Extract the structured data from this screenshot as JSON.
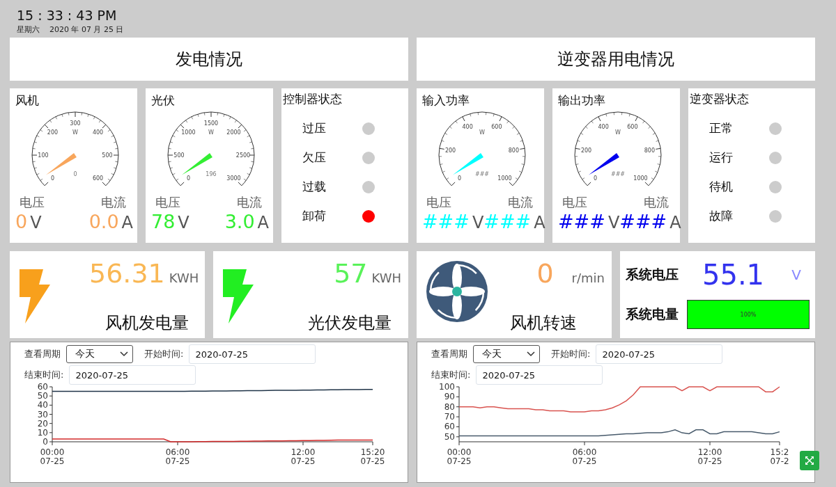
{
  "clock": {
    "time": "15 : 33 : 43 PM",
    "weekday": "星期六",
    "date": "2020 年 07 月 25 日"
  },
  "sections": [
    {
      "title": "发电情况",
      "gauges": [
        {
          "title": "风机",
          "unit": "W",
          "ticks": [
            "0",
            "100",
            "200",
            "300",
            "400",
            "500",
            "600"
          ],
          "reading": "0",
          "color": "#f8a65c",
          "voltage_label": "电压",
          "current_label": "电流",
          "voltage": "0",
          "voltage_unit": "V",
          "current": "0.0",
          "current_unit": "A"
        },
        {
          "title": "光伏",
          "unit": "W",
          "ticks": [
            "0",
            "500",
            "1000",
            "1500",
            "2000",
            "2500",
            "3000"
          ],
          "reading": "196",
          "color": "#33ee33",
          "voltage_label": "电压",
          "current_label": "电流",
          "voltage": "78",
          "voltage_unit": "V",
          "current": "3.0",
          "current_unit": "A"
        }
      ],
      "status": {
        "title": "控制器状态",
        "items": [
          {
            "label": "过压",
            "on": false
          },
          {
            "label": "欠压",
            "on": false
          },
          {
            "label": "过载",
            "on": false
          },
          {
            "label": "卸荷",
            "on": true
          }
        ]
      }
    },
    {
      "title": "逆变器用电情况",
      "gauges": [
        {
          "title": "输入功率",
          "unit": "W",
          "ticks": [
            "0",
            "200",
            "400",
            "600",
            "800",
            "1000"
          ],
          "reading": "###",
          "color": "#00ffff",
          "voltage_label": "电压",
          "current_label": "电流",
          "voltage": "###",
          "voltage_unit": "V",
          "current": "###",
          "current_unit": "A"
        },
        {
          "title": "输出功率",
          "unit": "W",
          "ticks": [
            "0",
            "200",
            "400",
            "600",
            "800",
            "1000"
          ],
          "reading": "###",
          "color": "#0000ee",
          "voltage_label": "电压",
          "current_label": "电流",
          "voltage": "###",
          "voltage_unit": "V",
          "current": "###",
          "current_unit": "A"
        }
      ],
      "status": {
        "title": "逆变器状态",
        "items": [
          {
            "label": "正常",
            "on": false
          },
          {
            "label": "运行",
            "on": false
          },
          {
            "label": "待机",
            "on": false
          },
          {
            "label": "故障",
            "on": false
          }
        ]
      }
    }
  ],
  "stats": [
    {
      "kind": "energy",
      "value": "56.31",
      "unit": "KWH",
      "label": "风机发电量",
      "color": "#f8a01c"
    },
    {
      "kind": "energy",
      "value": "57",
      "unit": "KWH",
      "label": "光伏发电量",
      "color": "#22ee22"
    },
    {
      "kind": "speed",
      "value": "0",
      "unit": "r/min",
      "label": "风机转速"
    },
    {
      "kind": "system",
      "voltage_label": "系统电压",
      "voltage": "55.1",
      "voltage_unit": "V",
      "charge_label": "系统电量",
      "level": 1,
      "charge_text": "100%"
    }
  ],
  "charts": [
    {
      "period_label": "查看周期",
      "period": "今天",
      "start_label": "开始时间:",
      "start": "2020-07-25",
      "end_label": "结束时间:",
      "end": "2020-07-25",
      "chart_data": {
        "type": "line",
        "categories": [
          "00:00 07-25",
          null,
          null,
          null,
          null,
          null,
          null,
          null,
          null,
          null,
          null,
          null,
          null,
          null,
          null,
          null,
          null,
          null,
          "06:00 07-25",
          null,
          null,
          null,
          null,
          null,
          null,
          null,
          null,
          null,
          null,
          null,
          null,
          null,
          null,
          null,
          null,
          null,
          "12:00 07-25",
          null,
          null,
          null,
          null,
          null,
          null,
          null,
          null,
          null,
          "15:20 07-25"
        ],
        "series": [
          {
            "color": "#1f3347",
            "values": [
              55,
              55,
              55,
              55,
              55,
              55,
              55,
              55,
              55,
              55,
              55,
              55,
              55,
              55,
              55,
              55,
              55,
              55,
              55,
              55.1,
              55.2,
              55.2,
              55.3,
              55.4,
              55.5,
              55.5,
              55.6,
              55.7,
              55.8,
              55.8,
              55.9,
              56,
              56.1,
              56.1,
              56.2,
              56.3,
              56.4,
              56.4,
              56.5,
              56.6,
              56.7,
              56.8,
              56.9,
              57,
              57,
              57.1,
              57.2
            ]
          },
          {
            "color": "#d42a2a",
            "values": [
              3,
              3,
              3,
              3,
              3,
              3,
              3,
              3,
              3,
              3,
              3,
              3,
              3,
              3,
              3,
              3,
              3,
              0,
              0,
              0.1,
              0.1,
              0.2,
              0.2,
              0.3,
              0.3,
              0.4,
              0.4,
              0.5,
              0.6,
              0.7,
              0.8,
              0.9,
              1,
              1,
              1.1,
              1.2,
              1.3,
              1.4,
              1.5,
              1.6,
              1.7,
              1.8,
              1.8,
              1.9,
              1.9,
              2,
              2
            ]
          }
        ],
        "ylim": [
          0,
          60
        ],
        "yticks": [
          0,
          10,
          20,
          30,
          40,
          50,
          60
        ]
      }
    },
    {
      "period_label": "查看周期",
      "period": "今天",
      "start_label": "开始时间:",
      "start": "2020-07-25",
      "end_label": "结束时间:",
      "end": "2020-07-25",
      "chart_data": {
        "type": "line",
        "categories": [
          "00:00 07-25",
          null,
          null,
          null,
          null,
          null,
          null,
          null,
          null,
          null,
          null,
          null,
          null,
          null,
          null,
          null,
          null,
          null,
          "06:00 07-25",
          null,
          null,
          null,
          null,
          null,
          null,
          null,
          null,
          null,
          null,
          null,
          null,
          null,
          null,
          null,
          null,
          null,
          "12:00 07-25",
          null,
          null,
          null,
          null,
          null,
          null,
          null,
          null,
          null,
          "15:2 07-2"
        ],
        "series": [
          {
            "color": "#d9534f",
            "values": [
              80,
              80,
              80,
              79,
              80,
              80,
              79,
              78,
              78,
              78,
              78,
              77,
              77,
              76,
              76,
              76,
              75,
              75,
              75,
              76,
              76,
              77,
              79,
              82,
              86,
              92,
              100,
              100,
              100,
              100,
              100,
              100,
              96,
              100,
              100,
              100,
              96,
              100,
              100,
              100,
              100,
              100,
              100,
              100,
              95,
              95,
              100
            ]
          },
          {
            "color": "#475a6b",
            "values": [
              51,
              51,
              51,
              51,
              51,
              51,
              51,
              51,
              51,
              51,
              51,
              51,
              51,
              51,
              51,
              51,
              51,
              51,
              51,
              51,
              51,
              51.5,
              52,
              52.5,
              53,
              53,
              53.5,
              54,
              54,
              54,
              55,
              57,
              54,
              53,
              57,
              57,
              53,
              53,
              55,
              55,
              55,
              55,
              55,
              54,
              53,
              53,
              55
            ]
          }
        ],
        "ylim": [
          45,
          100
        ],
        "yticks": [
          50,
          60,
          70,
          80,
          90,
          100
        ]
      }
    }
  ]
}
